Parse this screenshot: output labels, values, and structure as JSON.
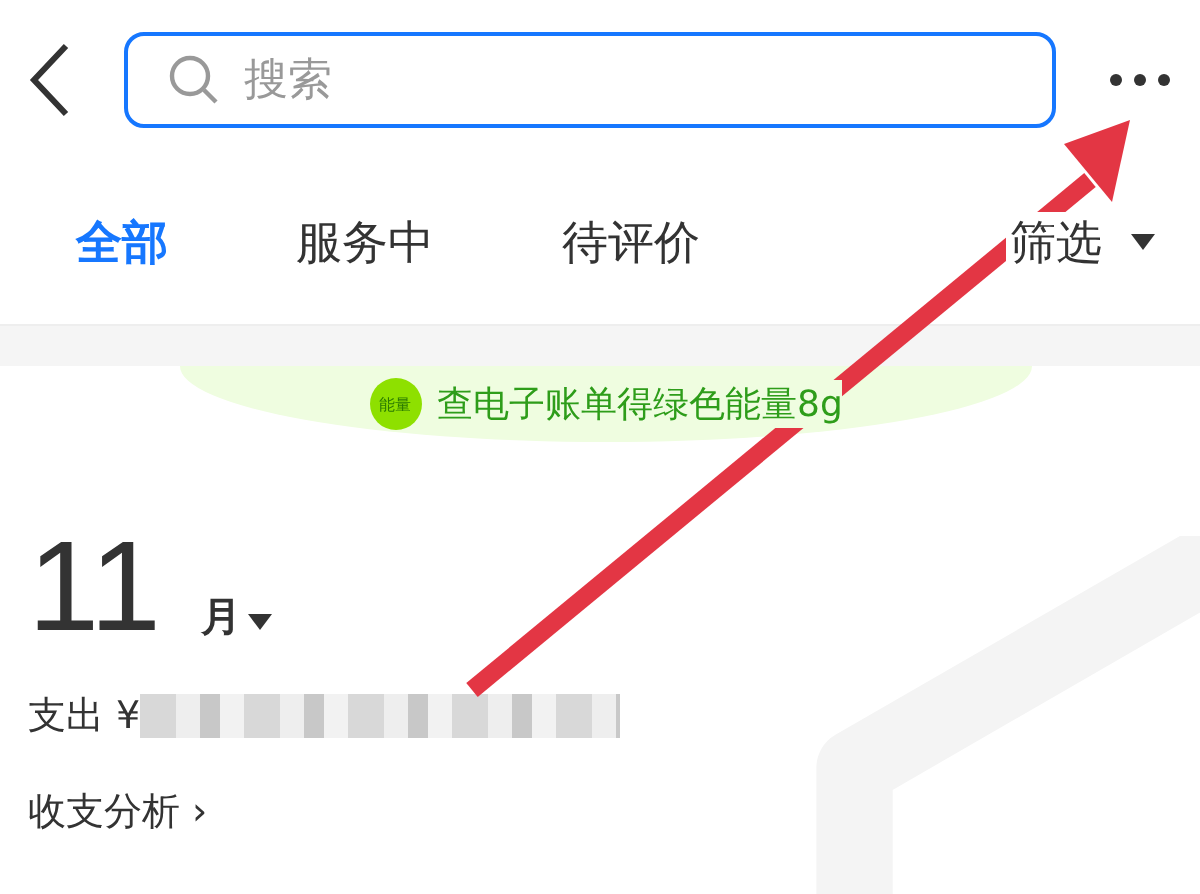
{
  "header": {
    "search": {
      "placeholder": "搜索"
    }
  },
  "tabs": [
    {
      "label": "全部",
      "selected": true
    },
    {
      "label": "服务中",
      "selected": false
    },
    {
      "label": "待评价",
      "selected": false
    }
  ],
  "filter": {
    "label": "筛选"
  },
  "banner": {
    "badge": "能量",
    "text": "查电子账单得绿色能量8g"
  },
  "summary": {
    "month": "11",
    "month_unit": "月",
    "expense_label": "支出 ¥",
    "analysis_link": "收支分析 ›"
  }
}
